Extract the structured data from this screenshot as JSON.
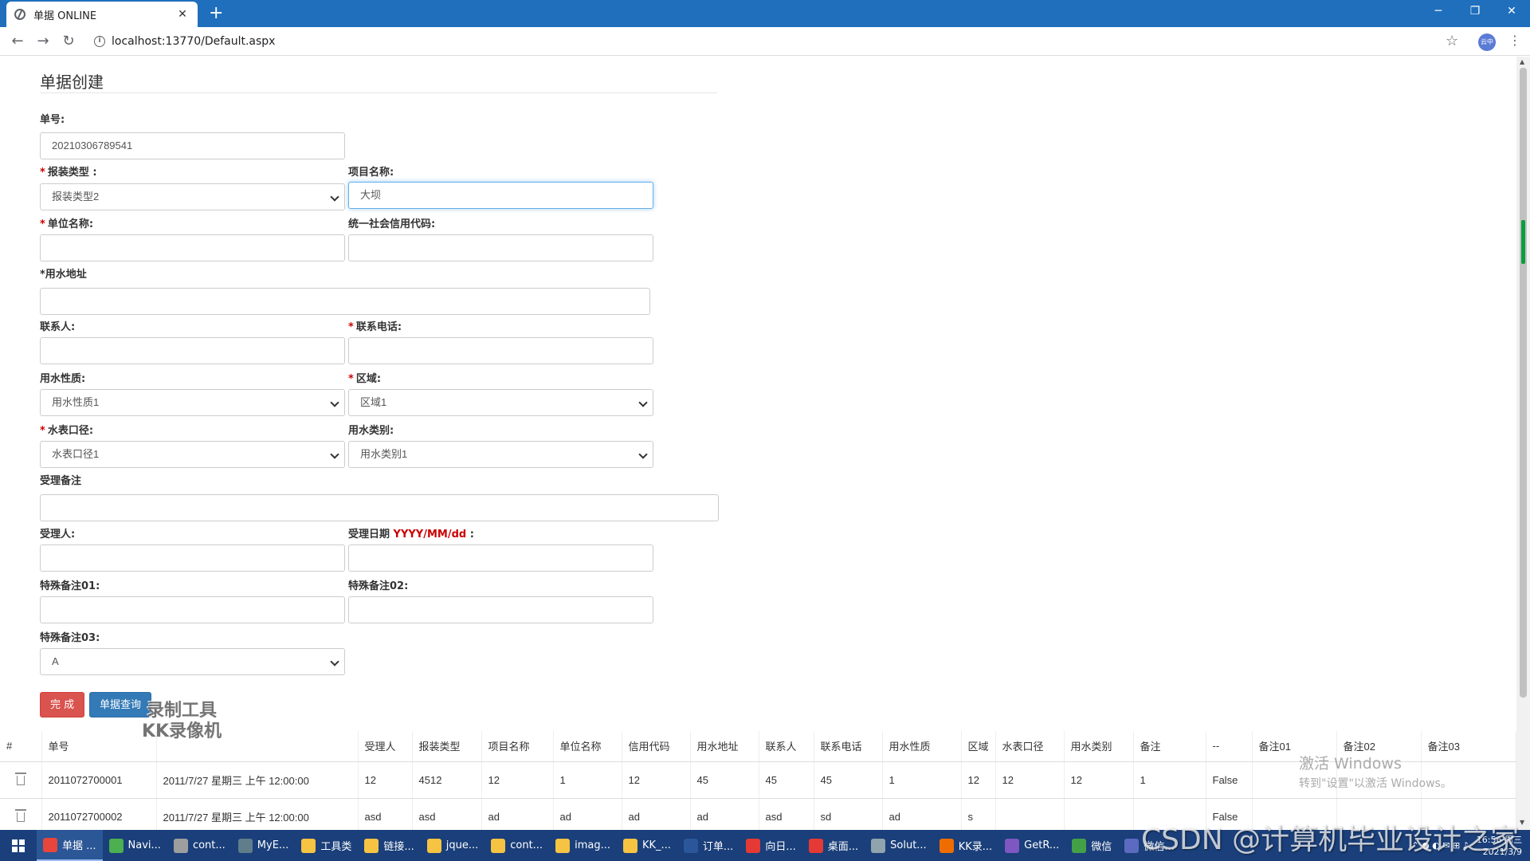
{
  "browser": {
    "tab_title": "单据 ONLINE",
    "url": "localhost:13770/Default.aspx",
    "profile_label": "云中"
  },
  "page": {
    "title": "单据创建"
  },
  "form": {
    "order_no": {
      "label": "单号:",
      "value": "20210306789541"
    },
    "pack_type": {
      "label": "报装类型 :",
      "value": "报装类型2",
      "required": true
    },
    "project_name": {
      "label": "项目名称:",
      "value": "大坝"
    },
    "unit_name": {
      "label": "单位名称:",
      "value": "",
      "required": true
    },
    "credit_code": {
      "label": "统一社会信用代码:",
      "value": ""
    },
    "water_address": {
      "label": "*用水地址",
      "value": ""
    },
    "contact": {
      "label": "联系人:",
      "value": ""
    },
    "contact_phone": {
      "label": "联系电话:",
      "value": "",
      "required": true
    },
    "water_nature": {
      "label": "用水性质:",
      "value": "用水性质1"
    },
    "region": {
      "label": "区域:",
      "value": "区域1",
      "required": true
    },
    "meter_caliber": {
      "label": "水表口径:",
      "value": "水表口径1",
      "required": true
    },
    "water_category": {
      "label": "用水类别:",
      "value": "用水类别1"
    },
    "accept_remark": {
      "label": "受理备注",
      "value": ""
    },
    "acceptor": {
      "label": "受理人:",
      "value": ""
    },
    "accept_date": {
      "label": "受理日期",
      "hint": "YYYY/MM/dd",
      "suffix": ":",
      "value": ""
    },
    "special01": {
      "label": "特殊备注01:",
      "value": ""
    },
    "special02": {
      "label": "特殊备注02:",
      "value": ""
    },
    "special03": {
      "label": "特殊备注03:",
      "value": "A"
    }
  },
  "buttons": {
    "finish": "完 成",
    "query": "单据查询"
  },
  "watermark": {
    "line1": "录制工具",
    "line2": "KK录像机"
  },
  "table": {
    "headers": [
      "#",
      "单号",
      "",
      "受理人",
      "报装类型",
      "项目名称",
      "单位名称",
      "信用代码",
      "用水地址",
      "联系人",
      "联系电话",
      "用水性质",
      "区域",
      "水表口径",
      "用水类别",
      "备注",
      "--",
      "备注01",
      "备注02",
      "备注03"
    ],
    "rows": [
      [
        "2011072700001",
        "2011/7/27 星期三 上午 12:00:00",
        "12",
        "4512",
        "12",
        "1",
        "12",
        "45",
        "45",
        "45",
        "1",
        "12",
        "12",
        "12",
        "1",
        "False",
        "",
        "",
        ""
      ],
      [
        "2011072700002",
        "2011/7/27 星期三 上午 12:00:00",
        "asd",
        "asd",
        "ad",
        "ad",
        "ad",
        "ad",
        "asd",
        "sd",
        "ad",
        "s",
        "",
        "",
        "",
        "False",
        "",
        "",
        ""
      ]
    ]
  },
  "activation": {
    "line1": "激活 Windows",
    "line2": "转到\"设置\"以激活 Windows。"
  },
  "taskbar": {
    "items": [
      {
        "label": "单据 ...",
        "color": "#e8453c"
      },
      {
        "label": "Navi...",
        "color": "#4caf50"
      },
      {
        "label": "cont...",
        "color": "#9e9e9e"
      },
      {
        "label": "MyE...",
        "color": "#607d8b"
      },
      {
        "label": "工具类",
        "color": "#f6c342"
      },
      {
        "label": "链接...",
        "color": "#f6c342"
      },
      {
        "label": "jque...",
        "color": "#f6c342"
      },
      {
        "label": "cont...",
        "color": "#f6c342"
      },
      {
        "label": "imag...",
        "color": "#f6c342"
      },
      {
        "label": "KK_...",
        "color": "#f6c342"
      },
      {
        "label": "订单...",
        "color": "#2b579a"
      },
      {
        "label": "向日...",
        "color": "#e53935"
      },
      {
        "label": "桌面...",
        "color": "#e53935"
      },
      {
        "label": "Solut...",
        "color": "#90a4ae"
      },
      {
        "label": "KK录...",
        "color": "#ef6c00"
      },
      {
        "label": "GetR...",
        "color": "#7e57c2"
      },
      {
        "label": "微信",
        "color": "#43a047"
      },
      {
        "label": "微信...",
        "color": "#5c6bc0"
      }
    ],
    "time": "16:56 周三",
    "date": "2021/3/9"
  },
  "overlay": {
    "csdn": "CSDN @计算机毕业设计之家"
  }
}
